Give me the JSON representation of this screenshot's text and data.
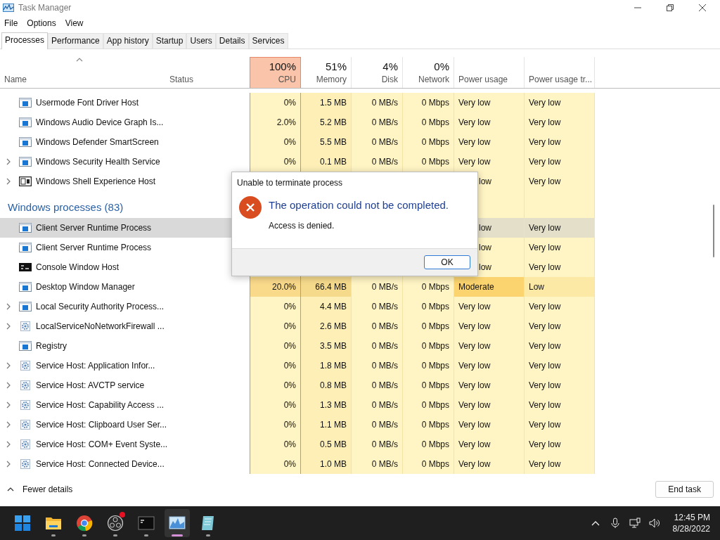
{
  "window": {
    "title": "Task Manager"
  },
  "menu": [
    "File",
    "Options",
    "View"
  ],
  "tabs": [
    {
      "label": "Processes",
      "selected": true
    },
    {
      "label": "Performance",
      "selected": false
    },
    {
      "label": "App history",
      "selected": false
    },
    {
      "label": "Startup",
      "selected": false
    },
    {
      "label": "Users",
      "selected": false
    },
    {
      "label": "Details",
      "selected": false
    },
    {
      "label": "Services",
      "selected": false
    }
  ],
  "columns": [
    {
      "label": "Name",
      "sorted": true
    },
    {
      "label": "Status"
    },
    {
      "label": "CPU",
      "summary": "100%",
      "hot": true
    },
    {
      "label": "Memory",
      "summary": "51%",
      "hot": false
    },
    {
      "label": "Disk",
      "summary": "4%",
      "hot": false
    },
    {
      "label": "Network",
      "summary": "0%",
      "hot": false
    },
    {
      "label": "Power usage"
    },
    {
      "label": "Power usage tr..."
    }
  ],
  "rows": [
    {
      "kind": "app",
      "expandable": false,
      "selected": false,
      "hot": false,
      "covered": false,
      "name": "Usermode Font Driver Host",
      "cpu": "0%",
      "memory": "1.5 MB",
      "disk": "0 MB/s",
      "network": "0 Mbps",
      "power": "Very low",
      "trend": "Very low"
    },
    {
      "kind": "app",
      "expandable": false,
      "selected": false,
      "hot": false,
      "covered": false,
      "name": "Windows Audio Device Graph Is...",
      "cpu": "2.0%",
      "memory": "5.2 MB",
      "disk": "0 MB/s",
      "network": "0 Mbps",
      "power": "Very low",
      "trend": "Very low"
    },
    {
      "kind": "app",
      "expandable": false,
      "selected": false,
      "hot": false,
      "covered": false,
      "name": "Windows Defender SmartScreen",
      "cpu": "0%",
      "memory": "5.5 MB",
      "disk": "0 MB/s",
      "network": "0 Mbps",
      "power": "Very low",
      "trend": "Very low"
    },
    {
      "kind": "app",
      "expandable": true,
      "selected": false,
      "hot": false,
      "covered": false,
      "name": "Windows Security Health Service",
      "cpu": "0%",
      "memory": "0.1 MB",
      "disk": "0 MB/s",
      "network": "0 Mbps",
      "power": "Very low",
      "trend": "Very low"
    },
    {
      "kind": "shell",
      "expandable": true,
      "selected": false,
      "hot": false,
      "covered": true,
      "name": "Windows Shell Experience Host",
      "power": "low",
      "trend": "Very low"
    },
    {
      "kind": "group",
      "name": "Windows processes (83)"
    },
    {
      "kind": "app",
      "expandable": false,
      "selected": true,
      "hot": false,
      "covered": true,
      "name": "Client Server Runtime Process",
      "power": "low",
      "trend": "Very low"
    },
    {
      "kind": "app",
      "expandable": false,
      "selected": false,
      "hot": false,
      "covered": true,
      "name": "Client Server Runtime Process",
      "power": "low",
      "trend": "Very low"
    },
    {
      "kind": "console",
      "expandable": false,
      "selected": false,
      "hot": false,
      "covered": true,
      "name": "Console Window Host",
      "power": "low",
      "trend": "Very low"
    },
    {
      "kind": "app",
      "expandable": false,
      "selected": false,
      "hot": true,
      "covered": false,
      "name": "Desktop Window Manager",
      "cpu": "20.0%",
      "memory": "66.4 MB",
      "disk": "0 MB/s",
      "network": "0 Mbps",
      "power": "Moderate",
      "trend": "Low"
    },
    {
      "kind": "app",
      "expandable": true,
      "selected": false,
      "hot": false,
      "covered": false,
      "name": "Local Security Authority Process...",
      "cpu": "0%",
      "memory": "4.4 MB",
      "disk": "0 MB/s",
      "network": "0 Mbps",
      "power": "Very low",
      "trend": "Very low"
    },
    {
      "kind": "service",
      "expandable": true,
      "selected": false,
      "hot": false,
      "covered": false,
      "name": "LocalServiceNoNetworkFirewall ...",
      "cpu": "0%",
      "memory": "2.6 MB",
      "disk": "0 MB/s",
      "network": "0 Mbps",
      "power": "Very low",
      "trend": "Very low"
    },
    {
      "kind": "app",
      "expandable": false,
      "selected": false,
      "hot": false,
      "covered": false,
      "name": "Registry",
      "cpu": "0%",
      "memory": "3.5 MB",
      "disk": "0 MB/s",
      "network": "0 Mbps",
      "power": "Very low",
      "trend": "Very low"
    },
    {
      "kind": "service",
      "expandable": true,
      "selected": false,
      "hot": false,
      "covered": false,
      "name": "Service Host: Application Infor...",
      "cpu": "0%",
      "memory": "1.8 MB",
      "disk": "0 MB/s",
      "network": "0 Mbps",
      "power": "Very low",
      "trend": "Very low"
    },
    {
      "kind": "service",
      "expandable": true,
      "selected": false,
      "hot": false,
      "covered": false,
      "name": "Service Host: AVCTP service",
      "cpu": "0%",
      "memory": "0.8 MB",
      "disk": "0 MB/s",
      "network": "0 Mbps",
      "power": "Very low",
      "trend": "Very low"
    },
    {
      "kind": "service",
      "expandable": true,
      "selected": false,
      "hot": false,
      "covered": false,
      "name": "Service Host: Capability Access ...",
      "cpu": "0%",
      "memory": "1.3 MB",
      "disk": "0 MB/s",
      "network": "0 Mbps",
      "power": "Very low",
      "trend": "Very low"
    },
    {
      "kind": "service",
      "expandable": true,
      "selected": false,
      "hot": false,
      "covered": false,
      "name": "Service Host: Clipboard User Ser...",
      "cpu": "0%",
      "memory": "1.1 MB",
      "disk": "0 MB/s",
      "network": "0 Mbps",
      "power": "Very low",
      "trend": "Very low"
    },
    {
      "kind": "service",
      "expandable": true,
      "selected": false,
      "hot": false,
      "covered": false,
      "name": "Service Host: COM+ Event Syste...",
      "cpu": "0%",
      "memory": "0.5 MB",
      "disk": "0 MB/s",
      "network": "0 Mbps",
      "power": "Very low",
      "trend": "Very low"
    },
    {
      "kind": "service",
      "expandable": true,
      "selected": false,
      "hot": false,
      "covered": false,
      "name": "Service Host: Connected Device...",
      "cpu": "0%",
      "memory": "1.0 MB",
      "disk": "0 MB/s",
      "network": "0 Mbps",
      "power": "Very low",
      "trend": "Very low"
    }
  ],
  "footer": {
    "toggle": "Fewer details",
    "button": "End task"
  },
  "dialog": {
    "title": "Unable to terminate process",
    "heading": "The operation could not be completed.",
    "message": "Access is denied.",
    "button": "OK"
  },
  "taskbar": {
    "apps": [
      {
        "kind": "start",
        "running": false,
        "selected": false,
        "badge": false
      },
      {
        "kind": "folder",
        "running": true,
        "selected": false,
        "badge": false
      },
      {
        "kind": "browser",
        "running": true,
        "selected": false,
        "badge": false
      },
      {
        "kind": "recorder",
        "running": true,
        "selected": false,
        "badge": true
      },
      {
        "kind": "terminal",
        "running": true,
        "selected": false,
        "badge": false
      },
      {
        "kind": "monitor",
        "running": true,
        "selected": true,
        "badge": false
      },
      {
        "kind": "notepad",
        "running": true,
        "selected": false,
        "badge": false
      }
    ],
    "time": "12:45 PM",
    "date": "8/28/2022"
  }
}
